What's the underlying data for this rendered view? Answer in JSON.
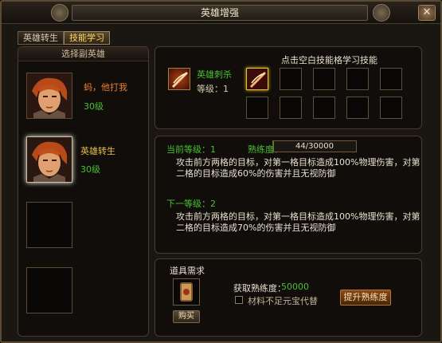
{
  "window": {
    "title": "英雄增强",
    "close_glyph": "✕"
  },
  "tabs": [
    {
      "label": "英雄转生",
      "active": false
    },
    {
      "label": "技能学习",
      "active": true
    }
  ],
  "left_panel": {
    "header": "选择副英雄",
    "heroes": [
      {
        "name": "蚂，他打我",
        "level": "30级",
        "selected": false
      },
      {
        "name": "英雄转生",
        "level": "30级",
        "selected": true
      }
    ]
  },
  "skill_panel": {
    "skill_name": "英雄刺杀",
    "level_label": "等级：1",
    "hint": "点击空白技能格学习技能",
    "slots_total": 10
  },
  "current_panel": {
    "current_label": "当前等级：1",
    "proficiency_label": "熟练度：",
    "proficiency_value": "44/30000",
    "proficiency_fraction": 0.0015,
    "current_desc": "攻击前方两格的目标，对第一格目标造成100%物理伤害，对第二格的目标造成60%的伤害并且无视防御",
    "next_label": "下一等级：2",
    "next_desc": "攻击前方两格的目标，对第一格目标造成100%物理伤害，对第二格的目标造成70%的伤害并且无视防御"
  },
  "item_panel": {
    "header": "道具需求",
    "buy_label": "购买",
    "gain_label": "获取熟练度：",
    "gain_value": "50000",
    "checkbox_label": "材料不足元宝代替",
    "upgrade_label": "提升熟练度"
  },
  "colors": {
    "accent": "#ffd860",
    "green": "#48c030",
    "orange": "#e88030"
  },
  "icons": [
    "close-icon",
    "skill-slash-icon",
    "scroll-icon"
  ]
}
